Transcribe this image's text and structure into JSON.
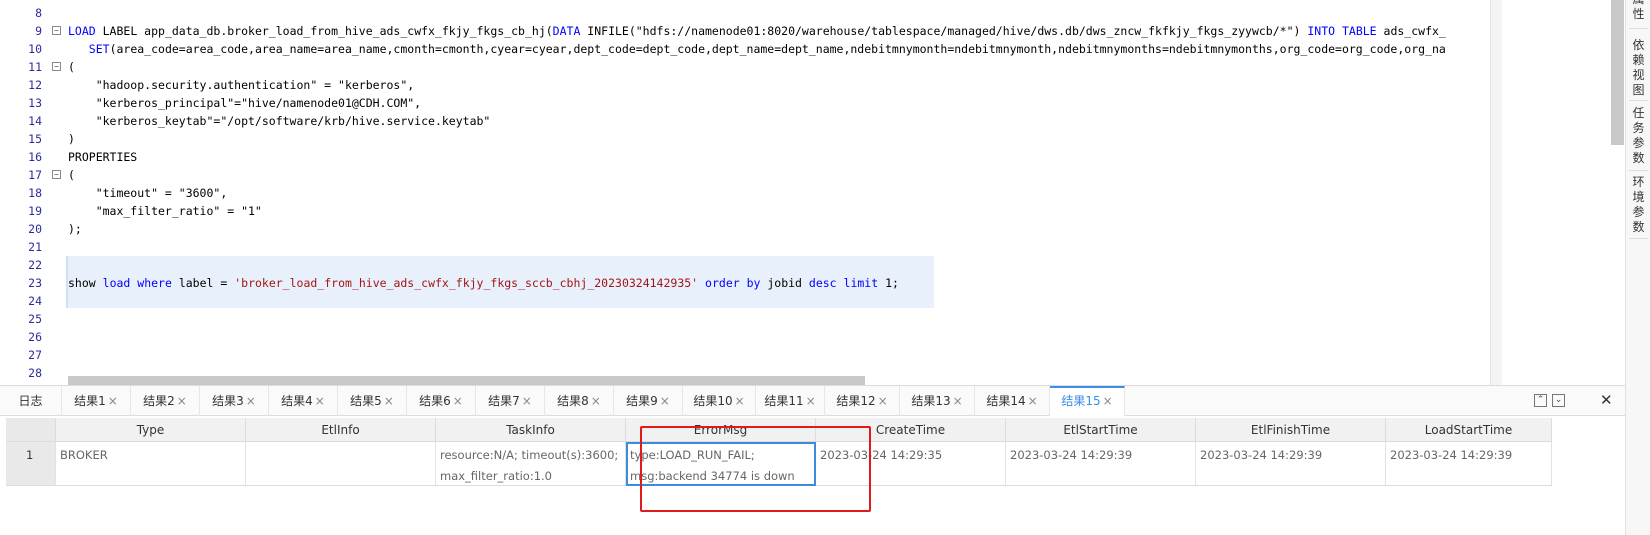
{
  "editor": {
    "lines": [
      {
        "n": "8",
        "fold": "",
        "tokens": [
          {
            "t": "    ",
            "c": "plain"
          }
        ]
      },
      {
        "n": "9",
        "fold": "⊟",
        "tokens": [
          {
            "t": "LOAD",
            "c": "kw"
          },
          {
            "t": " LABEL app_data_db.broker_load_from_hive_ads_cwfx_fkjy_fkgs_cb_hj(",
            "c": "plain"
          },
          {
            "t": "DATA",
            "c": "kw"
          },
          {
            "t": " INFILE(\"hdfs://namenode01:8020/warehouse/tablespace/managed/hive/dws.db/dws_zncw_fkfkjy_fkgs_zyywcb/*\") ",
            "c": "plain"
          },
          {
            "t": "INTO TABLE",
            "c": "kw"
          },
          {
            "t": " ads_cwfx_",
            "c": "plain"
          }
        ]
      },
      {
        "n": "10",
        "fold": "",
        "tokens": [
          {
            "t": "   ",
            "c": "plain"
          },
          {
            "t": "SET",
            "c": "kw"
          },
          {
            "t": "(area_code=area_code,area_name=area_name,cmonth=cmonth,cyear=cyear,dept_code=dept_code,dept_name=dept_name,ndebitmnymonth=ndebitmnymonth,ndebitmnymonths=ndebitmnymonths,org_code=org_code,org_na",
            "c": "plain"
          }
        ]
      },
      {
        "n": "11",
        "fold": "⊟",
        "tokens": [
          {
            "t": "(",
            "c": "plain"
          }
        ]
      },
      {
        "n": "12",
        "fold": "",
        "tokens": [
          {
            "t": "    \"hadoop.security.authentication\" = \"kerberos\",",
            "c": "plain"
          }
        ]
      },
      {
        "n": "13",
        "fold": "",
        "tokens": [
          {
            "t": "    \"kerberos_principal\"=\"hive/namenode01@CDH.COM\",",
            "c": "plain"
          }
        ]
      },
      {
        "n": "14",
        "fold": "",
        "tokens": [
          {
            "t": "    \"kerberos_keytab\"=\"/opt/software/krb/hive.service.keytab\"",
            "c": "plain"
          }
        ]
      },
      {
        "n": "15",
        "fold": "",
        "tokens": [
          {
            "t": ")",
            "c": "plain"
          }
        ]
      },
      {
        "n": "16",
        "fold": "",
        "tokens": [
          {
            "t": "PROPERTIES",
            "c": "plain"
          }
        ]
      },
      {
        "n": "17",
        "fold": "⊟",
        "tokens": [
          {
            "t": "(",
            "c": "plain"
          }
        ]
      },
      {
        "n": "18",
        "fold": "",
        "tokens": [
          {
            "t": "    \"timeout\" = \"3600\",",
            "c": "plain"
          }
        ]
      },
      {
        "n": "19",
        "fold": "",
        "tokens": [
          {
            "t": "    \"max_filter_ratio\" = \"1\"",
            "c": "plain"
          }
        ]
      },
      {
        "n": "20",
        "fold": "",
        "tokens": [
          {
            "t": ");",
            "c": "plain"
          }
        ]
      },
      {
        "n": "21",
        "fold": "",
        "tokens": []
      },
      {
        "n": "22",
        "fold": "",
        "tokens": []
      },
      {
        "n": "23",
        "fold": "",
        "tokens": [
          {
            "t": "show",
            "c": "plain"
          },
          {
            "t": " ",
            "c": "plain"
          },
          {
            "t": "load",
            "c": "kw"
          },
          {
            "t": " ",
            "c": "plain"
          },
          {
            "t": "where",
            "c": "kw"
          },
          {
            "t": " label = ",
            "c": "plain"
          },
          {
            "t": "'broker_load_from_hive_ads_cwfx_fkjy_fkgs_sccb_cbhj_20230324142935'",
            "c": "str"
          },
          {
            "t": " ",
            "c": "plain"
          },
          {
            "t": "order by",
            "c": "kw"
          },
          {
            "t": " jobid ",
            "c": "plain"
          },
          {
            "t": "desc limit",
            "c": "kw"
          },
          {
            "t": " 1;",
            "c": "plain"
          }
        ]
      },
      {
        "n": "24",
        "fold": "",
        "tokens": []
      },
      {
        "n": "25",
        "fold": "",
        "tokens": []
      },
      {
        "n": "26",
        "fold": "",
        "tokens": []
      },
      {
        "n": "27",
        "fold": "",
        "tokens": []
      },
      {
        "n": "28",
        "fold": "",
        "tokens": []
      }
    ]
  },
  "side_panel": {
    "tabs": [
      {
        "label": "属\n性"
      },
      {
        "label": "依\n赖\n视\n图"
      },
      {
        "label": "任\n务\n参\n数"
      },
      {
        "label": "环\n境\n参\n数"
      }
    ]
  },
  "result_tabs": {
    "log_label": "日志",
    "tabs": [
      "结果1",
      "结果2",
      "结果3",
      "结果4",
      "结果5",
      "结果6",
      "结果7",
      "结果8",
      "结果9",
      "结果10",
      "结果11",
      "结果12",
      "结果13",
      "结果14",
      "结果15"
    ],
    "active": "结果15",
    "close_glyph": "×",
    "expand_glyph": "⌃",
    "collapse_glyph": "⌄",
    "close_panel_glyph": "✕"
  },
  "grid": {
    "columns": [
      "Type",
      "EtlInfo",
      "TaskInfo",
      "ErrorMsg",
      "CreateTime",
      "EtlStartTime",
      "EtlFinishTime",
      "LoadStartTime"
    ],
    "rows": [
      {
        "num": "1",
        "cells": [
          "BROKER",
          "",
          "resource:N/A; timeout(s):3600; max_filter_ratio:1.0",
          "type:LOAD_RUN_FAIL; msg:backend 34774 is down",
          "2023-03-24 14:29:35",
          "2023-03-24 14:29:39",
          "2023-03-24 14:29:39",
          "2023-03-24 14:29:39"
        ]
      }
    ]
  },
  "colors": {
    "keyword": "#0000ff",
    "string": "#a31515",
    "active_tab": "#3c8ee6",
    "highlight_box": "#e01b1b"
  }
}
